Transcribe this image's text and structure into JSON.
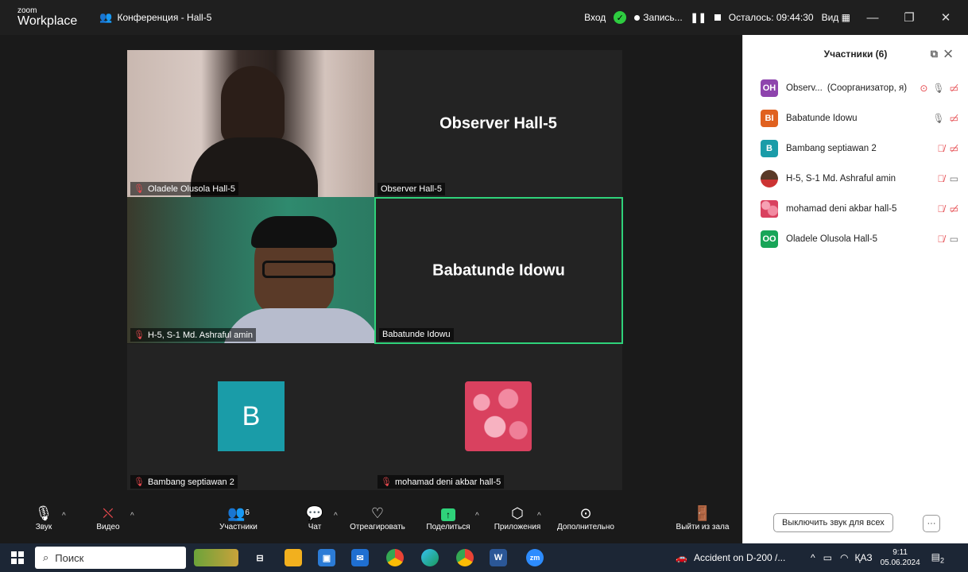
{
  "titlebar": {
    "logo_line1": "zoom",
    "logo_line2": "Workplace",
    "conference_title": "Конференция - Hall-5",
    "signin": "Вход",
    "recording": "Запись...",
    "remaining": "Осталось: 09:44:30",
    "view": "Вид"
  },
  "tiles": [
    {
      "name": "Oladele Olusola Hall-5",
      "big": ""
    },
    {
      "name": "Observer Hall-5",
      "big": "Observer Hall-5"
    },
    {
      "name": "H-5, S-1 Md. Ashraful amin",
      "big": ""
    },
    {
      "name": "Babatunde Idowu",
      "big": "Babatunde Idowu"
    },
    {
      "name": "Bambang septiawan 2",
      "big": "",
      "avatar_letter": "B"
    },
    {
      "name": "mohamad deni akbar hall-5",
      "big": ""
    }
  ],
  "panel": {
    "title": "Участники (6)",
    "participants": [
      {
        "initials": "OH",
        "color": "#8e44ad",
        "name": "Observ...",
        "role": "(Соорганизатор, я)"
      },
      {
        "initials": "BI",
        "color": "#e0611f",
        "name": "Babatunde Idowu",
        "role": ""
      },
      {
        "initials": "B",
        "color": "#1a9ca8",
        "name": "Bambang septiawan 2",
        "role": ""
      },
      {
        "initials": "",
        "color": "",
        "name": "H-5, S-1 Md. Ashraful amin",
        "role": ""
      },
      {
        "initials": "",
        "color": "",
        "name": "mohamad deni akbar hall-5",
        "role": ""
      },
      {
        "initials": "OO",
        "color": "#18a558",
        "name": "Oladele Olusola Hall-5",
        "role": ""
      }
    ],
    "mute_all": "Выключить звук для всех"
  },
  "toolbar": {
    "audio": "Звук",
    "video": "Видео",
    "participants": "Участники",
    "participants_count": "6",
    "chat": "Чат",
    "react": "Отреагировать",
    "share": "Поделиться",
    "apps": "Приложения",
    "more": "Дополнительно",
    "leave": "Выйти из зала"
  },
  "taskbar": {
    "search": "Поиск",
    "news": "Accident on D-200 /...",
    "lang": "ҚАЗ",
    "time": "9:11",
    "date": "05.06.2024",
    "notif_count": "2"
  }
}
